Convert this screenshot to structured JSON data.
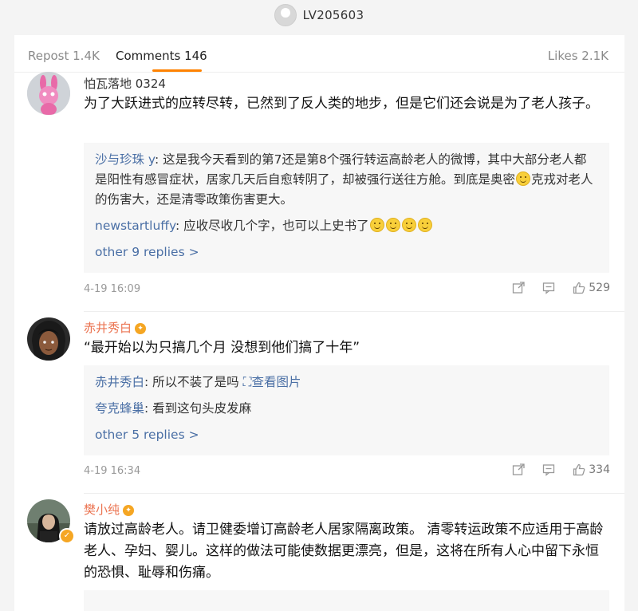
{
  "header": {
    "username": "LV205603"
  },
  "tabs": {
    "repost": "Repost 1.4K",
    "comments": "Comments 146",
    "likes": "Likes 2.1K"
  },
  "comments": [
    {
      "user": "怕瓦落地 0324",
      "text": "为了大跃进式的应转尽转，已然到了反人类的地步，但是它们还会说是为了老人孩子。",
      "replies": [
        {
          "name": "沙与珍珠 y",
          "text_a": ": 这是我今天看到的第7还是第8个强行转运高龄老人的微博，其中大部分老人都是阳性有感冒症状，居家几天后自愈转阴了，却被强行送往方舱。到底是奥密",
          "text_b": "克戎对老人的伤害大，还是清零政策伤害更大。"
        },
        {
          "name": "newstartluffy",
          "text": ": 应收尽收几个字，也可以上史书了"
        }
      ],
      "more": "other 9 replies >",
      "date": "4-19 16:09",
      "likes": "529"
    },
    {
      "user": "赤井秀白",
      "text": "“最开始以为只搞几个月 没想到他们搞了十年”",
      "replies": [
        {
          "name": "赤井秀白",
          "text": ": 所以不装了是吗 ",
          "link": "查看图片"
        },
        {
          "name": "夸克蜂巢",
          "text": ": 看到这句头皮发麻"
        }
      ],
      "more": "other 5 replies >",
      "date": "4-19 16:34",
      "likes": "334"
    },
    {
      "user": "樊小纯",
      "text": "请放过高龄老人。请卫健委增订高龄老人居家隔离政策。 清零转运政策不应适用于高龄老人、孕妇、婴儿。这样的做法可能使数据更漂亮，但是，这将在所有人心中留下永恒的恐惧、耻辱和伤痛。"
    }
  ]
}
